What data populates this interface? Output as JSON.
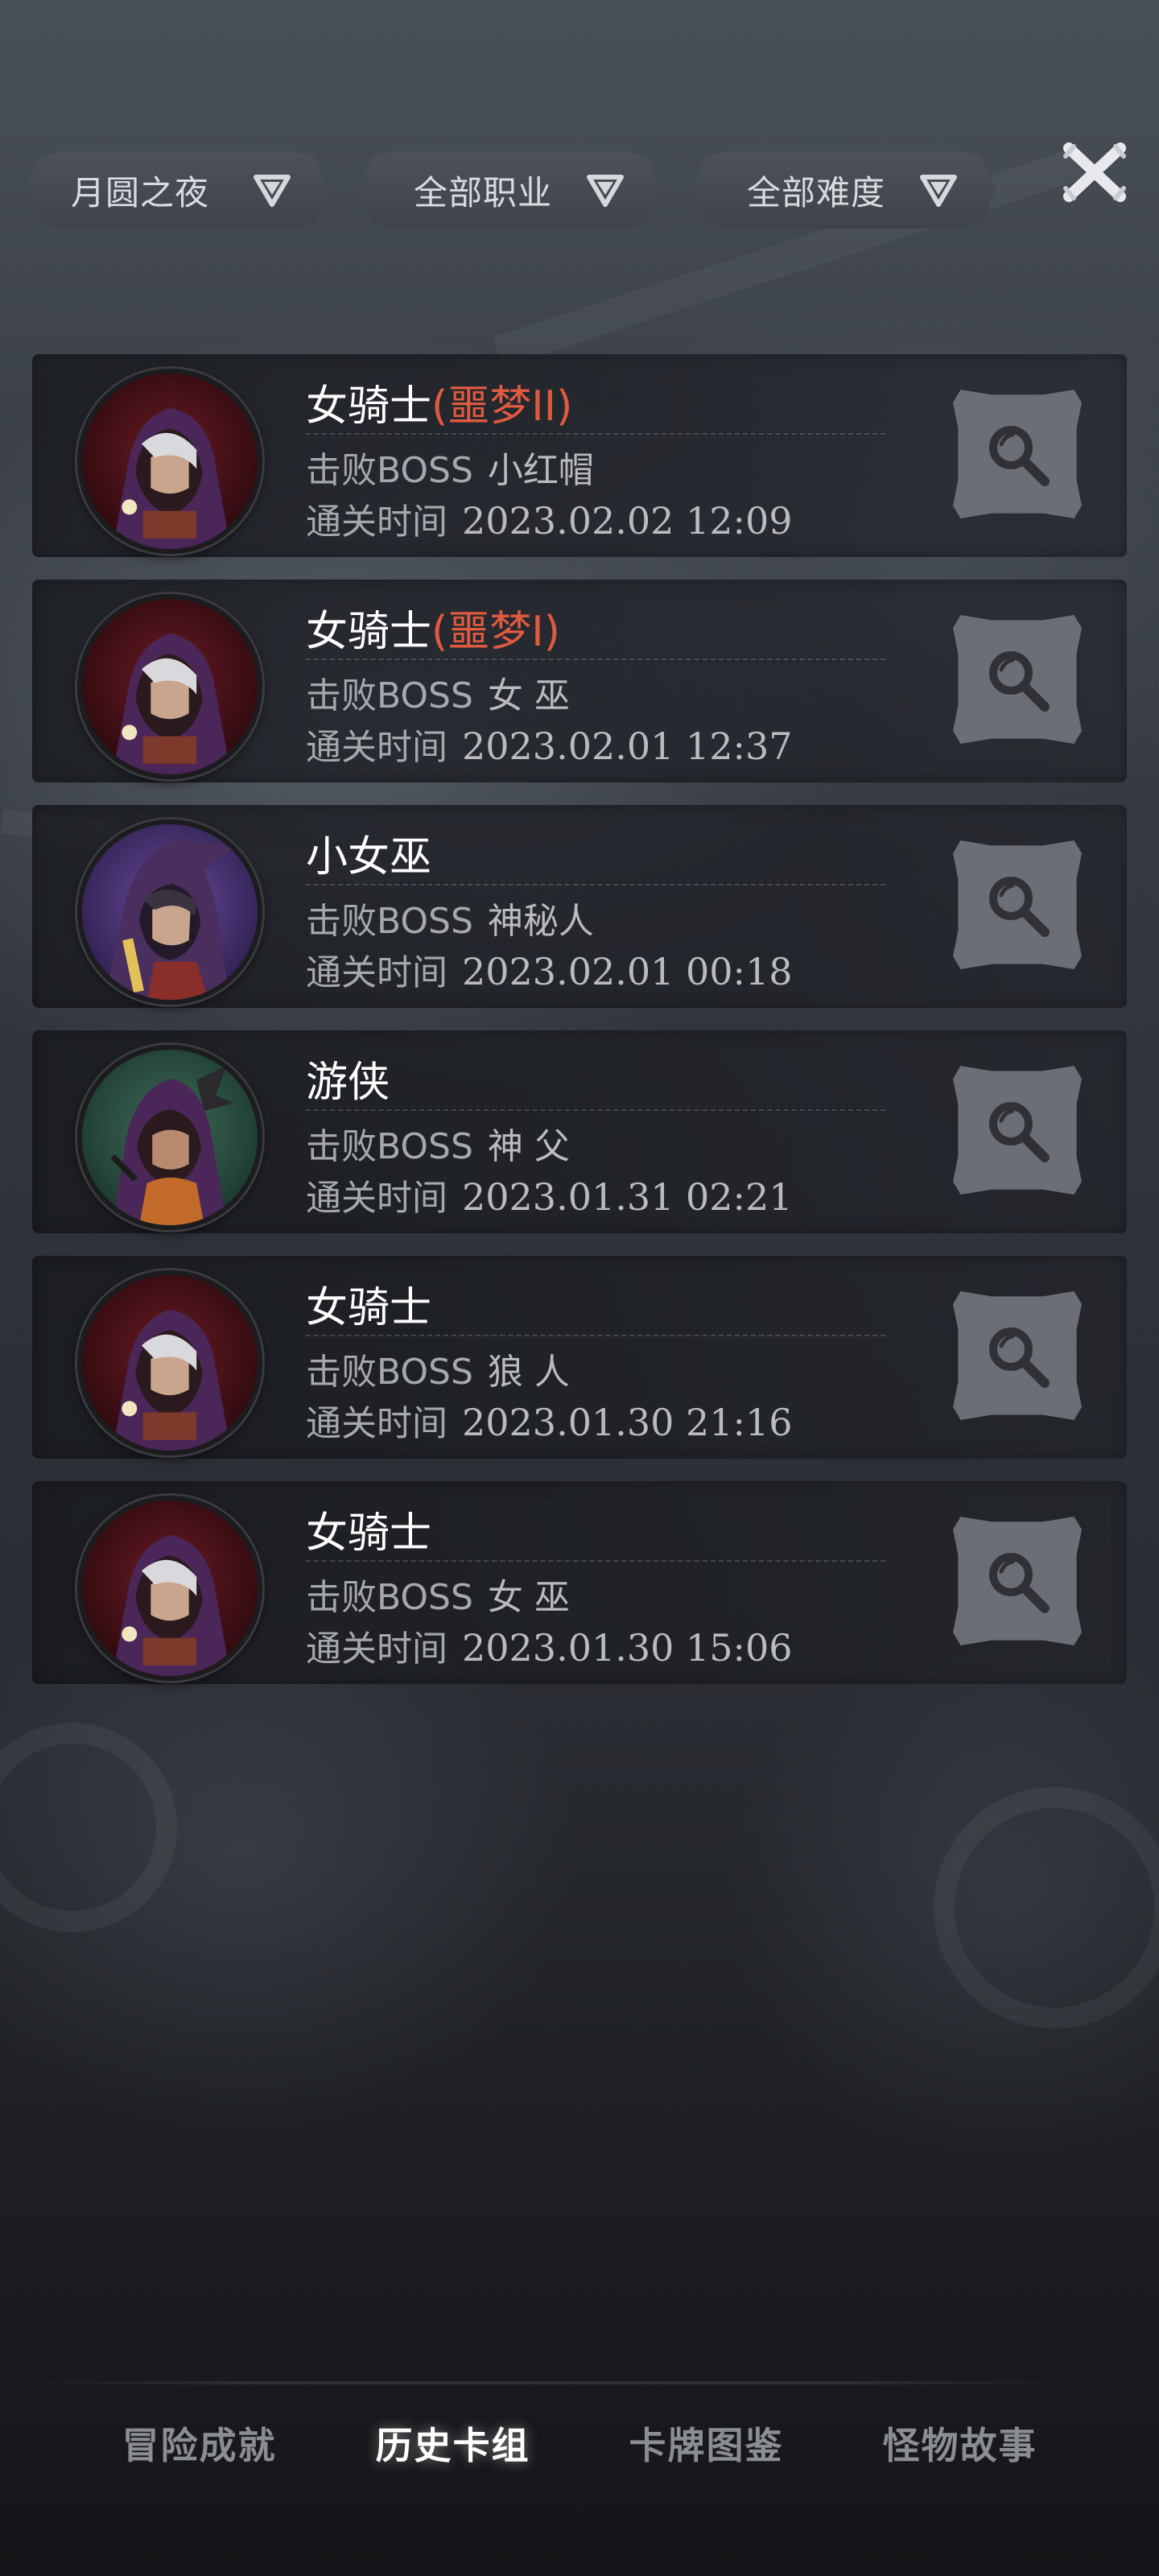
{
  "filters": [
    {
      "label": "月圆之夜",
      "icon": "chevron-down-icon"
    },
    {
      "label": "全部职业",
      "icon": "chevron-down-icon"
    },
    {
      "label": "全部难度",
      "icon": "chevron-down-icon"
    }
  ],
  "close_icon": "close-icon",
  "records": [
    {
      "hero": "女骑士",
      "difficulty": "(噩梦II)",
      "boss_label": "击败BOSS",
      "boss": "小红帽",
      "time_label": "通关时间",
      "time": "2023.02.02 12:09",
      "avatar": "knight"
    },
    {
      "hero": "女骑士",
      "difficulty": "(噩梦I)",
      "boss_label": "击败BOSS",
      "boss": "女 巫",
      "time_label": "通关时间",
      "time": "2023.02.01 12:37",
      "avatar": "knight"
    },
    {
      "hero": "小女巫",
      "difficulty": "",
      "boss_label": "击败BOSS",
      "boss": "神秘人",
      "time_label": "通关时间",
      "time": "2023.02.01 00:18",
      "avatar": "witch"
    },
    {
      "hero": "游侠",
      "difficulty": "",
      "boss_label": "击败BOSS",
      "boss": "神 父",
      "time_label": "通关时间",
      "time": "2023.01.31 02:21",
      "avatar": "ranger"
    },
    {
      "hero": "女骑士",
      "difficulty": "",
      "boss_label": "击败BOSS",
      "boss": "狼 人",
      "time_label": "通关时间",
      "time": "2023.01.30 21:16",
      "avatar": "knight"
    },
    {
      "hero": "女骑士",
      "difficulty": "",
      "boss_label": "击败BOSS",
      "boss": "女 巫",
      "time_label": "通关时间",
      "time": "2023.01.30 15:06",
      "avatar": "knight"
    }
  ],
  "view_icon": "search-icon",
  "tabs": [
    {
      "label": "冒险成就",
      "active": false
    },
    {
      "label": "历史卡组",
      "active": true
    },
    {
      "label": "卡牌图鉴",
      "active": false
    },
    {
      "label": "怪物故事",
      "active": false
    }
  ],
  "colors": {
    "difficulty": "#e05a40",
    "muted_text": "#a5a8ad",
    "button_bg": "#6b6e74"
  }
}
